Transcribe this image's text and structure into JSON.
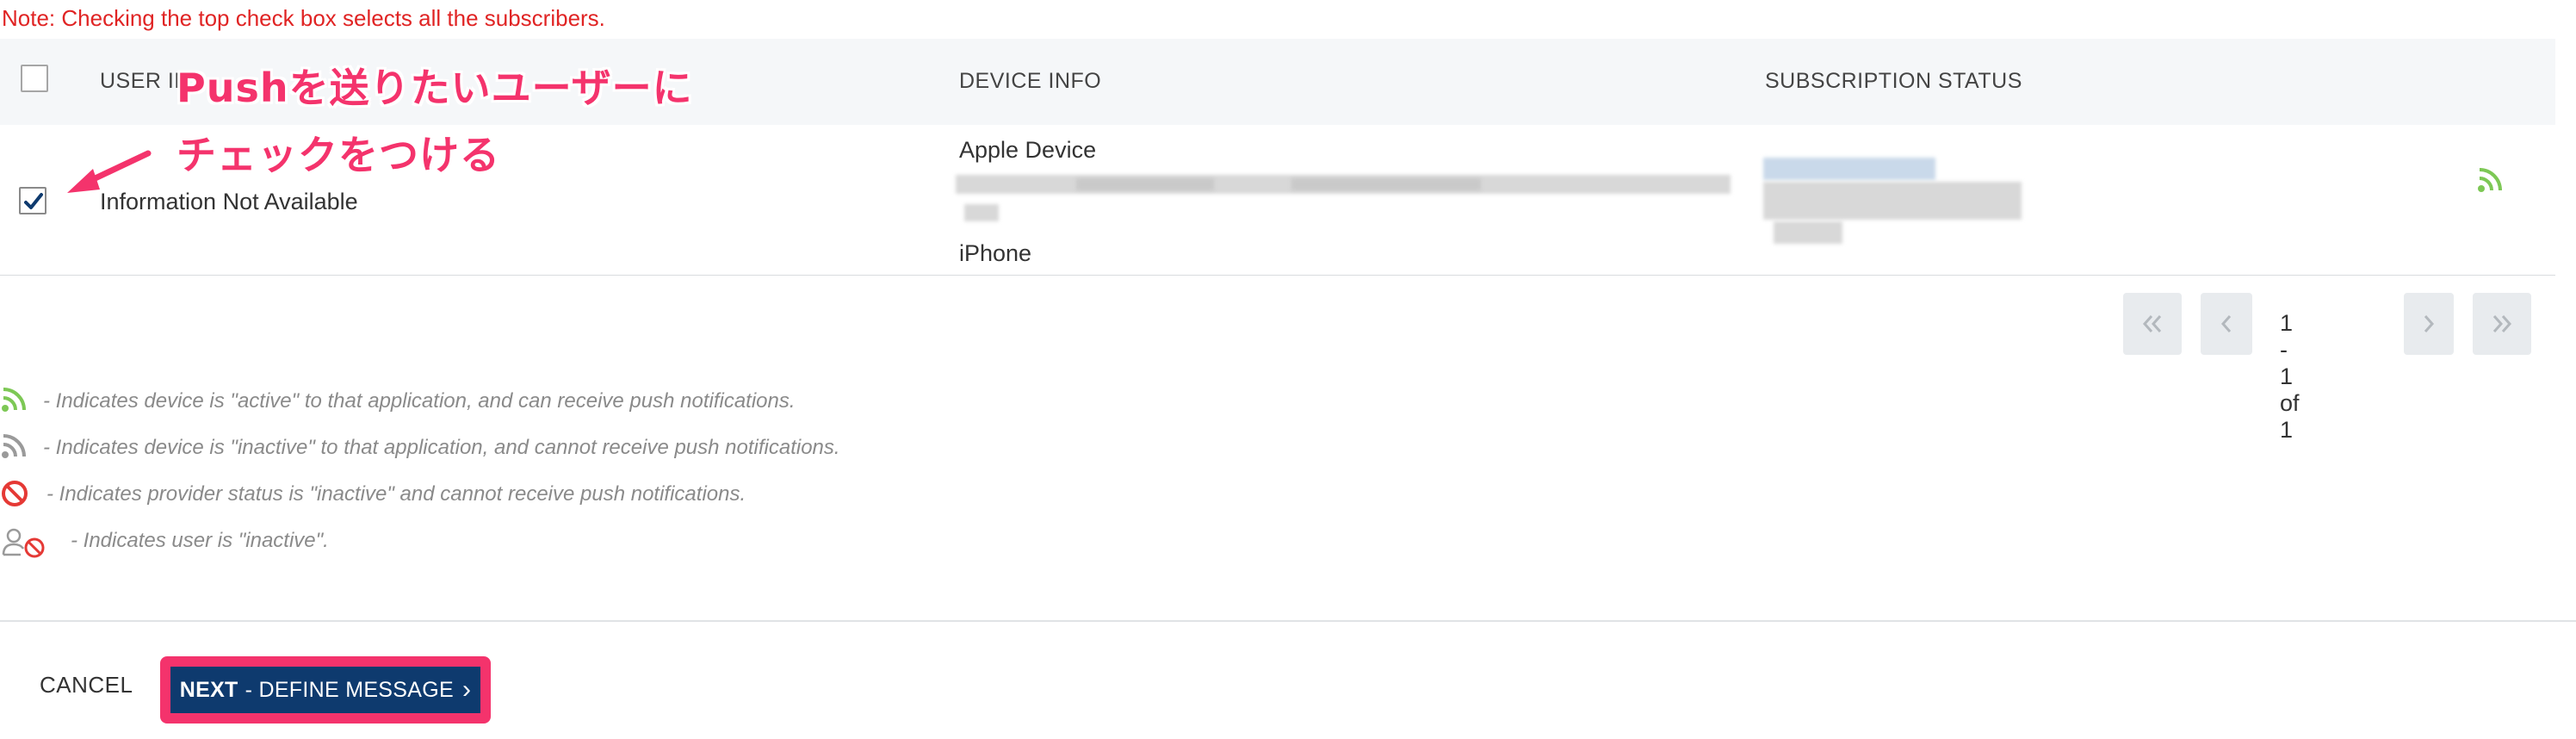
{
  "note": "Note: Checking the top check box selects all the subscribers.",
  "table": {
    "headers": {
      "user_info": "USER IN",
      "device_info": "DEVICE INFO",
      "subscription_status": "SUBSCRIPTION STATUS"
    },
    "rows": [
      {
        "checked": true,
        "user_info": "Information Not Available",
        "device_type": "Apple Device",
        "device_model": "iPhone",
        "status_icon": "rss-active-icon"
      }
    ]
  },
  "pagination": {
    "info": "1 - 1 of 1"
  },
  "legend": [
    {
      "icon": "rss-active-icon",
      "color": "#7dc855",
      "text": "- Indicates device is \"active\" to that application, and can receive push notifications."
    },
    {
      "icon": "rss-inactive-icon",
      "color": "#9a9a9a",
      "text": "- Indicates device is \"inactive\" to that application, and cannot receive push notifications."
    },
    {
      "icon": "prohibited-icon",
      "color": "#e53935",
      "text": "- Indicates provider status is \"inactive\" and cannot receive push notifications."
    },
    {
      "icon": "user-inactive-icon",
      "color": "#e53935",
      "text": "- Indicates user is \"inactive\"."
    }
  ],
  "footer": {
    "cancel_label": "CANCEL",
    "next_strong": "NEXT",
    "next_label": "- DEFINE MESSAGE",
    "next_chevron": "›"
  },
  "annotation": {
    "line1": "Pushを送りたいユーザーに",
    "line2": "チェックをつける",
    "color": "#f4336c"
  }
}
